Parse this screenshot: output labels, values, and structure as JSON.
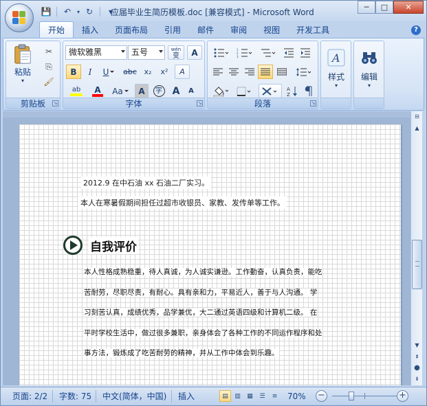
{
  "window": {
    "title": "应届毕业生简历模板.doc [兼容模式] - Microsoft Word",
    "controls": {
      "minimize": "─",
      "maximize": "□",
      "close": "✕"
    }
  },
  "qat": {
    "save": "💾",
    "undo": "↶",
    "redo": "↻",
    "customize": "▾"
  },
  "tabs": [
    "开始",
    "插入",
    "页面布局",
    "引用",
    "邮件",
    "审阅",
    "视图",
    "开发工具"
  ],
  "help": "?",
  "ribbon": {
    "clipboard": {
      "label": "剪贴板",
      "paste": "粘贴",
      "cut": "✂",
      "copy": "⎘",
      "format_painter": "🖌"
    },
    "font": {
      "label": "字体",
      "font_name": "微软雅黑",
      "font_size": "五号",
      "phonetic": "wén",
      "phonetic_char": "变",
      "char_border": "A",
      "bold": "B",
      "italic": "I",
      "underline": "U",
      "strike": "abc",
      "sub": "x₂",
      "sup": "x²",
      "clear": "A",
      "highlight": "ab",
      "font_color": "A",
      "change_case": "Aa",
      "char_shading": "A",
      "enclose": "字",
      "grow": "A",
      "shrink": "A"
    },
    "paragraph": {
      "label": "段落"
    },
    "styles": {
      "label": "样式",
      "icon": "A"
    },
    "editing": {
      "label": "编辑",
      "icon": "₳"
    }
  },
  "document": {
    "line1": "2012.9 在中石油 xx 石油二厂实习。",
    "line2": "本人在寒暑假期间担任过超市收银员、家教、发传单等工作。",
    "heading": "自我评价",
    "paragraph": [
      "本人性格成熟稳重，待人真诚，为人诚实谦逊。工作勤奋，认真负责，能吃",
      "苦耐劳，尽职尽责，有耐心。具有亲和力，平易近人，善于与人沟通。    学",
      "习刻苦认真，成绩优秀，品学兼优，大二通过英语四级和计算机二级。    在",
      "平时学校生活中，做过很多兼职，亲身体会了各种工作的不同运作程序和处",
      "事方法，锻炼成了吃苦耐劳的精神，并从工作中体会到乐趣。"
    ]
  },
  "statusbar": {
    "page": "页面: 2/2",
    "words": "字数: 75",
    "language": "中文(简体，中国)",
    "mode": "插入",
    "zoom": "70%",
    "zoom_out": "−",
    "zoom_in": "+"
  },
  "colors": {
    "accent": "#15428b",
    "highlight": "#ffff00",
    "font_color": "#ff0000"
  }
}
